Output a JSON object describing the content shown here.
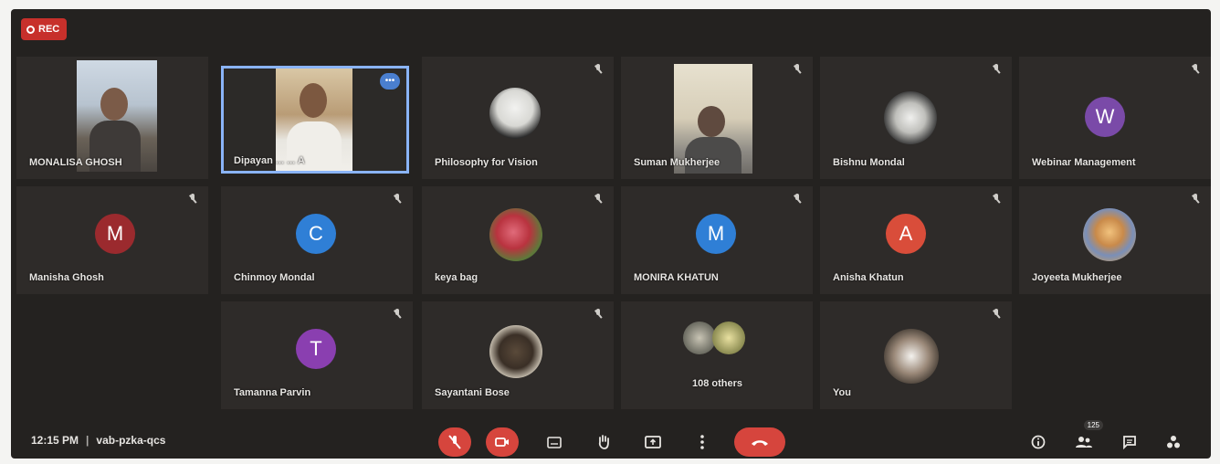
{
  "recording": {
    "label": "REC"
  },
  "tiles": [
    {
      "name": "MONALISA GHOSH"
    },
    {
      "name": "Dipayan ... ... A"
    },
    {
      "name": "Philosophy for Vision"
    },
    {
      "name": "Suman Mukherjee"
    },
    {
      "name": "Bishnu Mondal"
    },
    {
      "name": "Webinar Management",
      "initial": "W"
    },
    {
      "name": "Manisha Ghosh",
      "initial": "M"
    },
    {
      "name": "Chinmoy Mondal",
      "initial": "C"
    },
    {
      "name": "keya bag"
    },
    {
      "name": "MONIRA KHATUN",
      "initial": "M"
    },
    {
      "name": "Anisha Khatun",
      "initial": "A"
    },
    {
      "name": "Joyeeta Mukherjee"
    },
    {
      "name": "Tamanna Parvin",
      "initial": "T"
    },
    {
      "name": "Sayantani Bose"
    },
    {
      "name": "108 others"
    },
    {
      "name": "You"
    }
  ],
  "active_tile_badge": "•••",
  "bottom_bar": {
    "time": "12:15 PM",
    "separator": "|",
    "meeting_code": "vab-pzka-qcs",
    "people_count": "125"
  },
  "colors": {
    "background": "#242220",
    "tile": "#2e2b29",
    "red": "#d6453d",
    "active_outline": "#8ab4f8"
  }
}
